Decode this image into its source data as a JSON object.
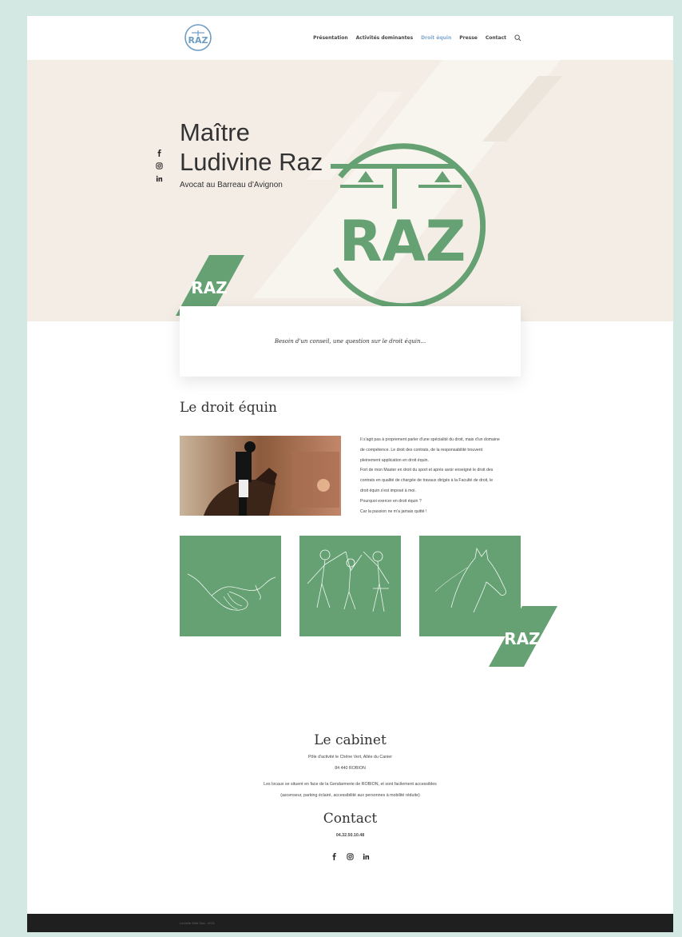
{
  "nav": {
    "items": [
      "Présentation",
      "Activités dominantes",
      "Droit équin",
      "Presse",
      "Contact"
    ],
    "active_index": 2
  },
  "hero": {
    "title_line1": "Maître",
    "title_line2": "Ludivine Raz",
    "subtitle": "Avocat au Barreau d'Avignon",
    "logo_text": "RAZ"
  },
  "cta": {
    "text": "Besoin d'un conseil, une question sur le droit équin..."
  },
  "droit_equin": {
    "title": "Le droit équin",
    "paragraph_lines": [
      "Il s'agit pas à proprement parler d'une spécialité du droit, mais d'un domaine",
      "de compétence. Le droit des contrats, de la responsabilité trouvent",
      "pleinement application en droit équin.",
      "Fort de mon Master en droit du sport et après avoir enseigné le droit des",
      "contrats en qualité de chargée de travaux dirigés à la Faculté de droit, le",
      "droit équin s'est imposé à moi.",
      "Pourquoi exercer en droit équin ?",
      "Car la passion ne m'a jamais quitté !"
    ]
  },
  "cabinet": {
    "title": "Le cabinet",
    "address_line1": "Pôle d'activité le Chêne Vert, Allée du Canier",
    "address_line2": "84 440 ROBION",
    "info_line1": "Les locaux se situent en face de la Gendarmerie de ROBION, et sont facilement accessibles",
    "info_line2": "(ascenseur, parking éclairé, accessibilité aux personnes à mobilité réduite)"
  },
  "contact": {
    "title": "Contact",
    "phone": "04.32.50.10.48"
  },
  "footer": {
    "text": "La belle Web Sud - 2021"
  },
  "colors": {
    "brand_green": "#65a172",
    "hero_bg": "#f3ede6",
    "nav_active": "#7fa7cc",
    "footer_bg": "#1f1f1f",
    "page_bg": "#d3e8e2"
  },
  "icons": [
    "facebook-icon",
    "instagram-icon",
    "linkedin-icon",
    "search-icon"
  ]
}
